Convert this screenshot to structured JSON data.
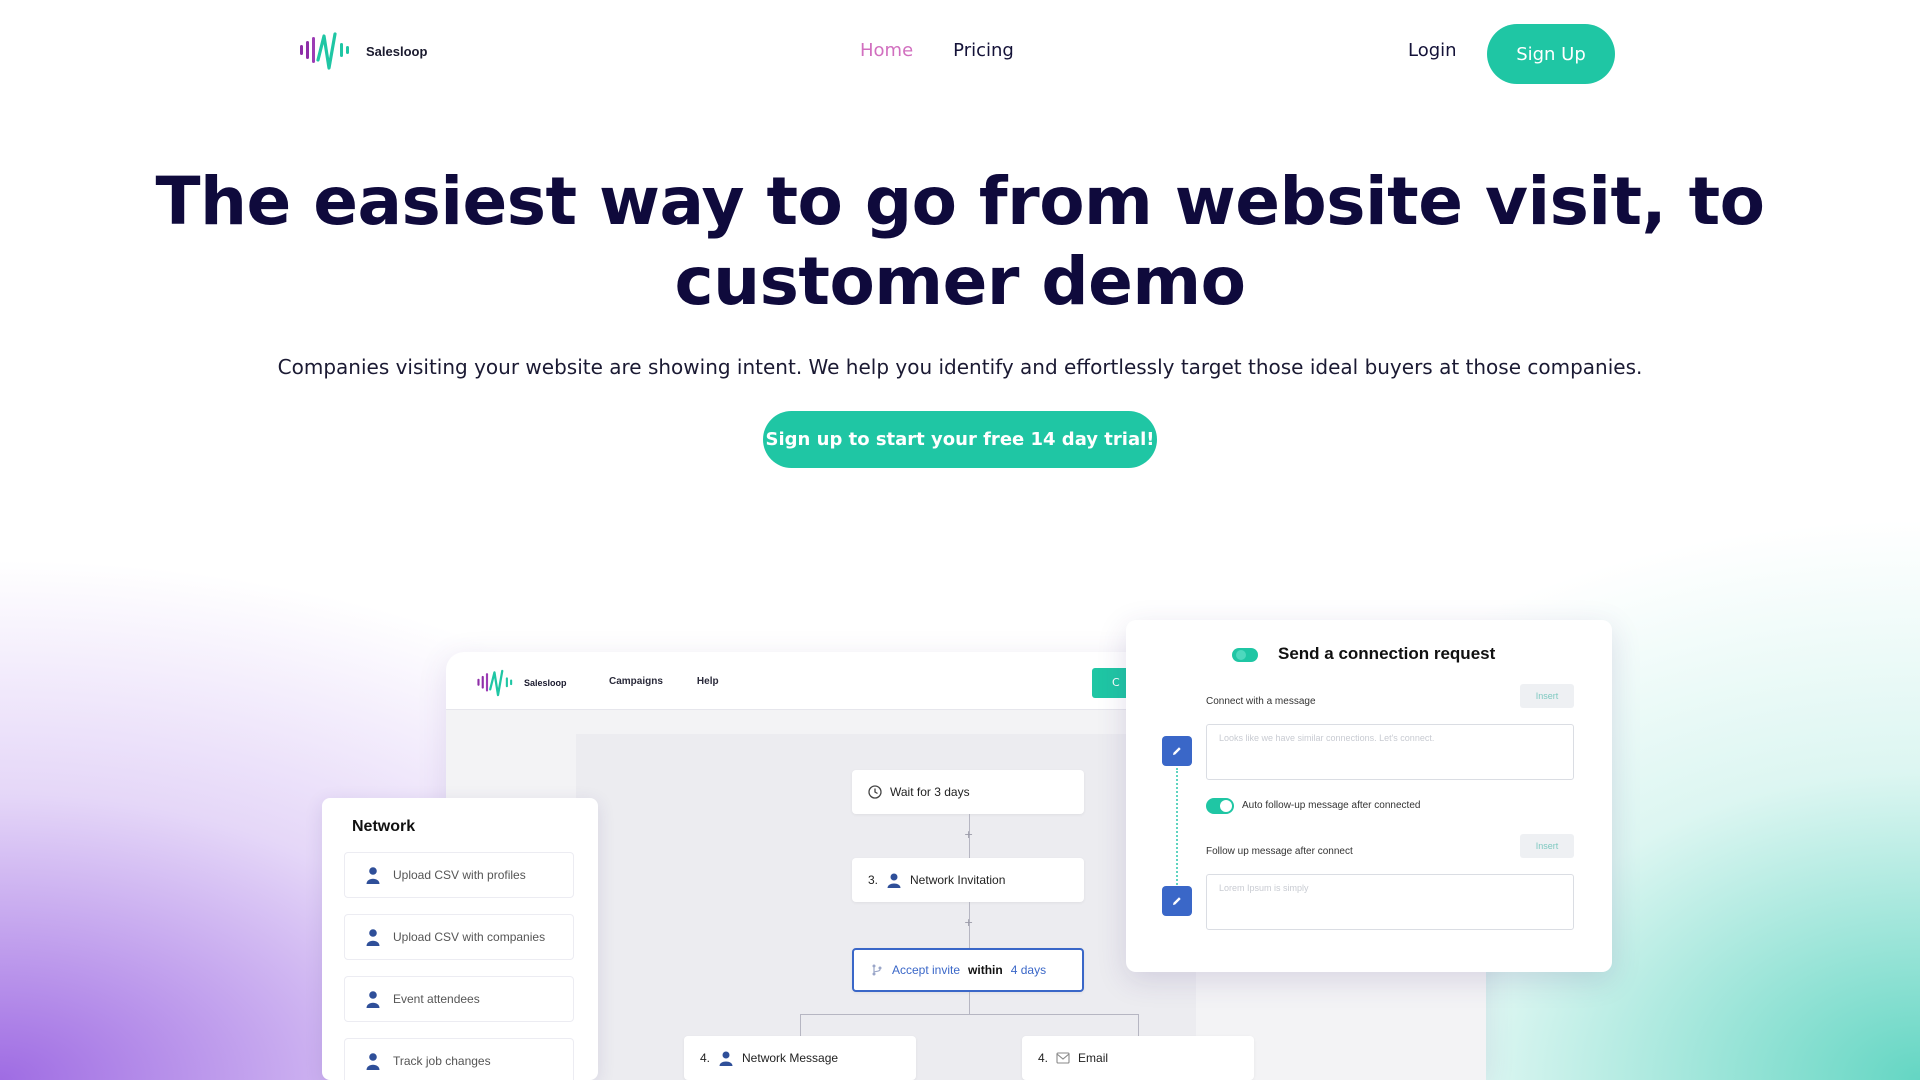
{
  "header": {
    "logo_text": "Salesloop",
    "nav": [
      {
        "label": "Home"
      },
      {
        "label": "Pricing"
      }
    ],
    "login_label": "Login",
    "signup_label": "Sign Up"
  },
  "hero": {
    "title": "The easiest way to go from website visit, to customer demo",
    "subtitle": "Companies visiting your website are showing intent. We help you identify and effortlessly target those ideal buyers at those companies.",
    "cta_label": "Sign up to start your free 14 day trial!"
  },
  "app_mock": {
    "logo_text": "Salesloop",
    "menu": [
      "Campaigns",
      "Help"
    ],
    "green_button_fragment": "C",
    "flow": {
      "wait": "Wait for 3 days",
      "step3_num": "3.",
      "step3_label": "Network Invitation",
      "accept_part1": "Accept invite",
      "accept_part2": "within",
      "accept_part3": "4 days",
      "step4a_num": "4.",
      "step4a_label": "Network Message",
      "step4b_num": "4.",
      "step4b_label": "Email"
    },
    "network_panel": {
      "title": "Network",
      "items": [
        "Upload CSV with profiles",
        "Upload CSV with companies",
        "Event attendees",
        "Track job changes"
      ]
    },
    "connection_card": {
      "title": "Send a connection request",
      "connect_label": "Connect with a message",
      "insert_label": "Insert",
      "message_placeholder": "Looks like we have similar connections. Let's connect.",
      "toggle_label": "Auto follow-up message after connected",
      "followup_label": "Follow up message after connect",
      "insert_label_2": "Insert",
      "followup_placeholder": "Lorem Ipsum is simply"
    }
  },
  "colors": {
    "accent": "#1fc6a4",
    "nav_active": "#d16fbf",
    "heading": "#0f0a3c",
    "node_blue": "#3a67c8"
  }
}
